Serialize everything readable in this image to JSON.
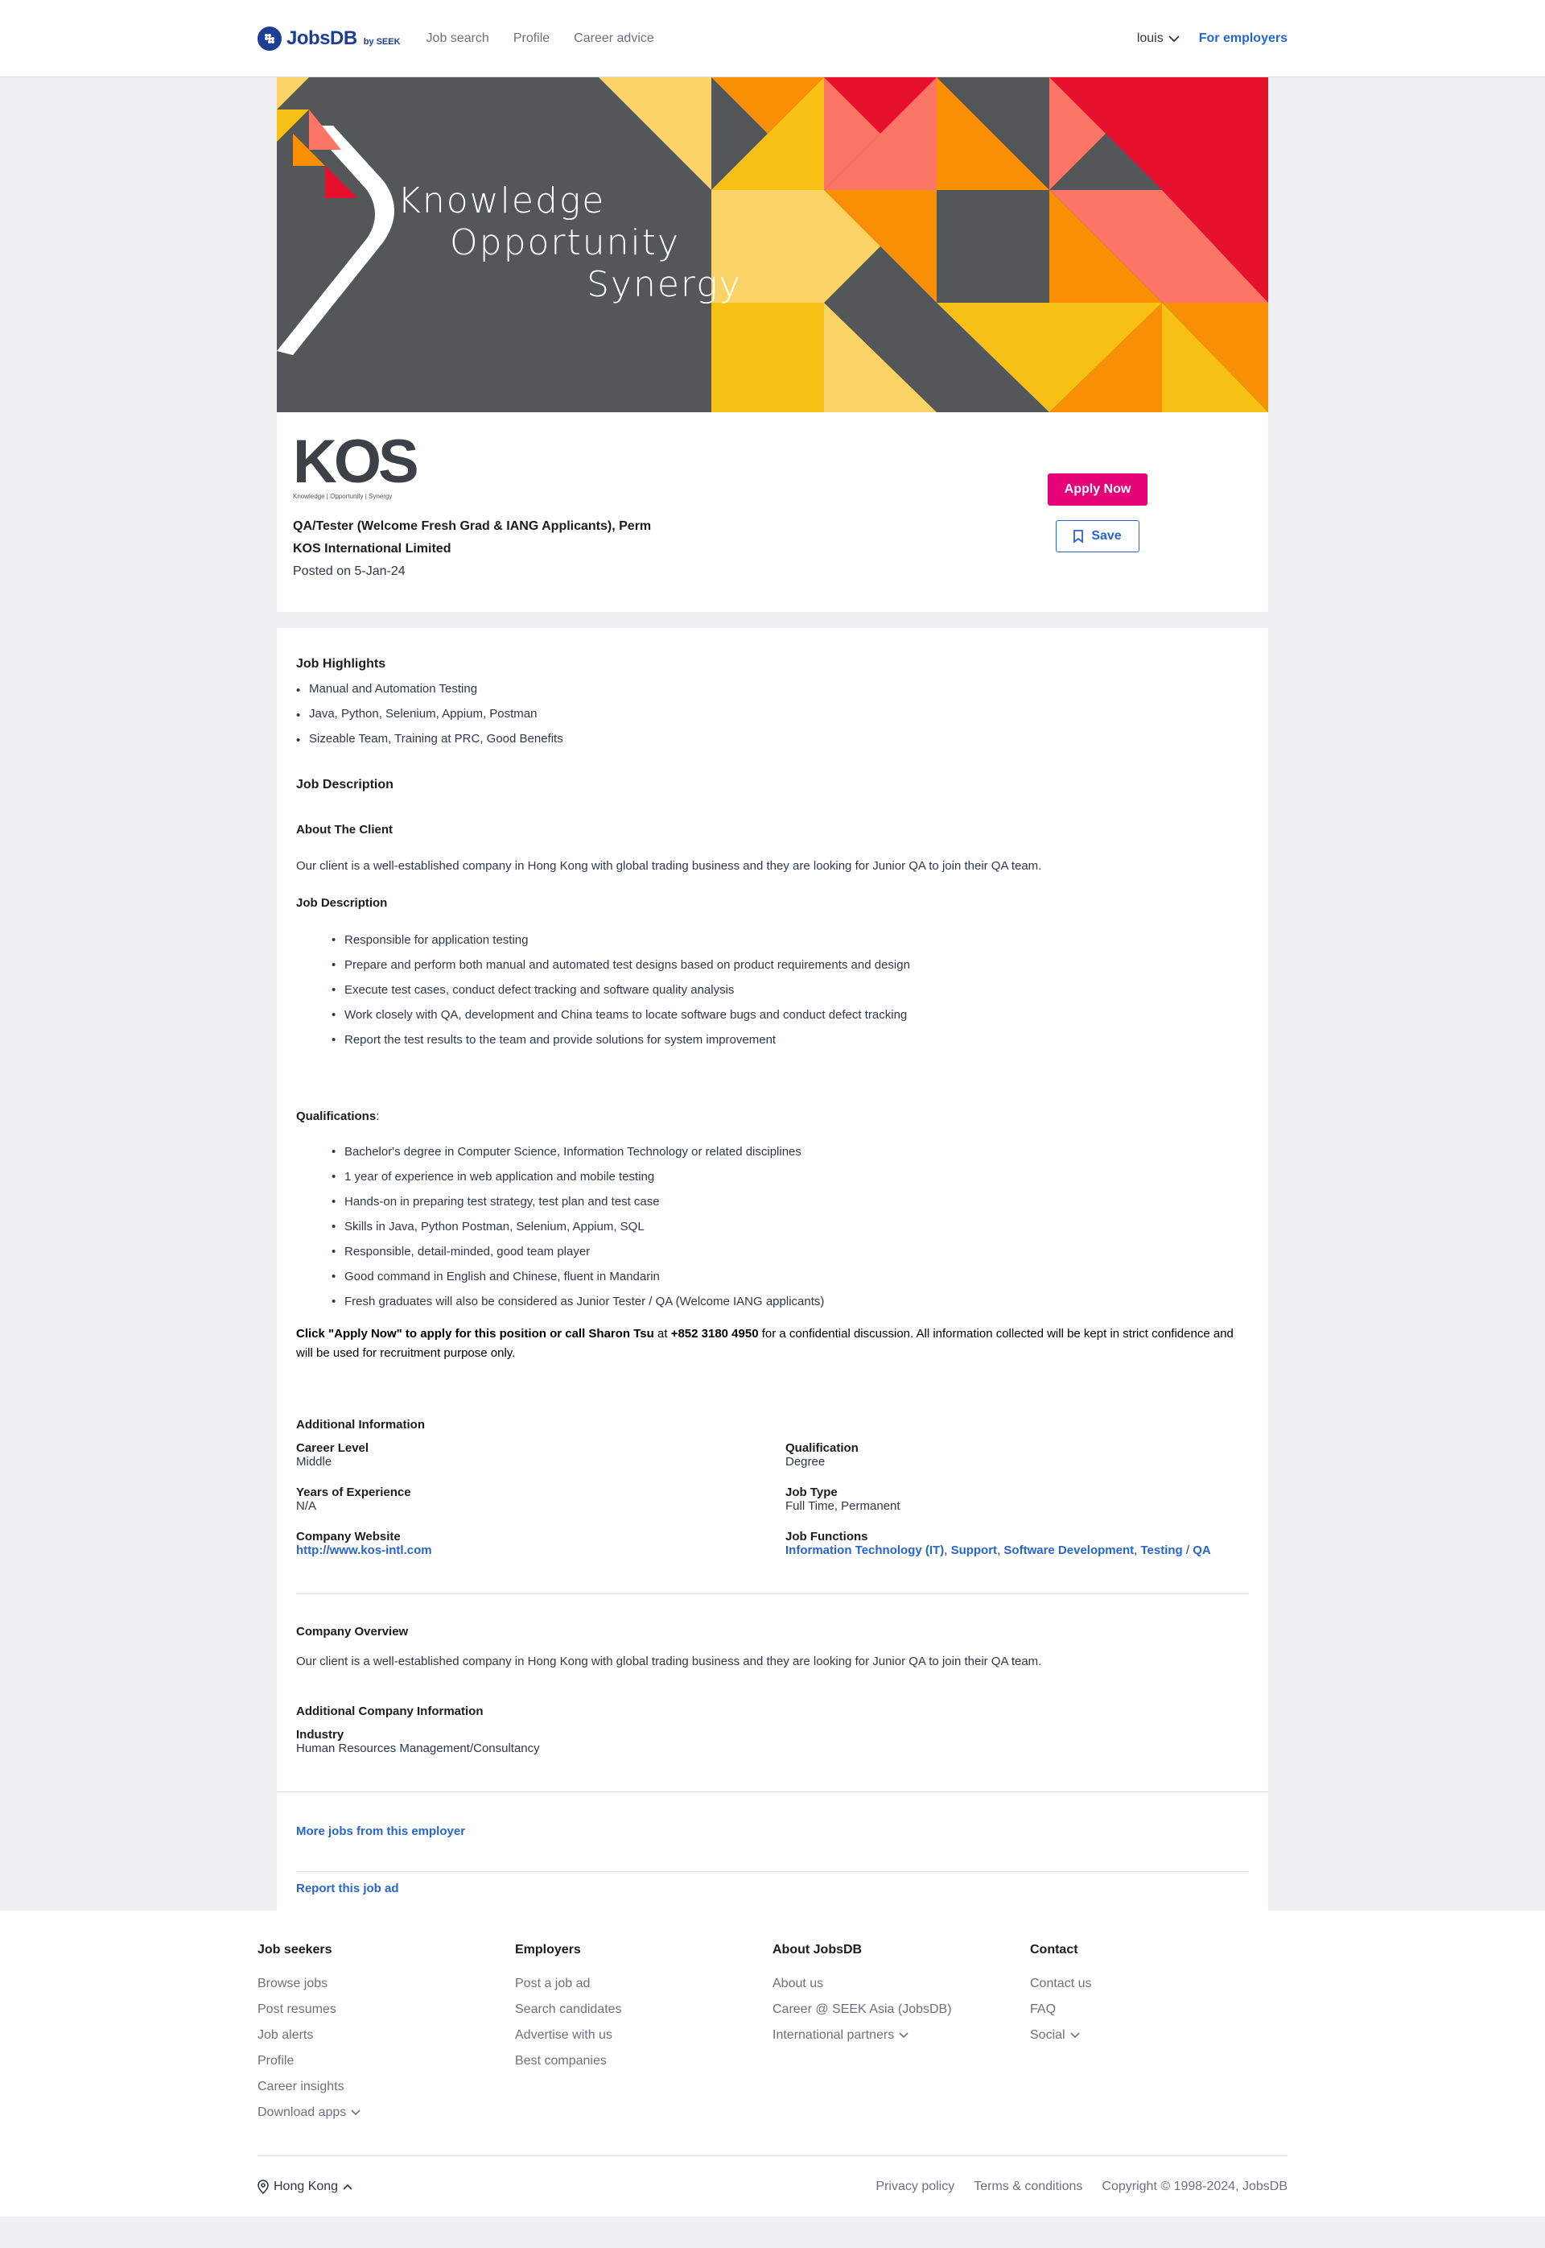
{
  "header": {
    "logo_text": "JobsDB",
    "logo_sub": "by SEEK",
    "nav": [
      "Job search",
      "Profile",
      "Career advice"
    ],
    "user": "louis",
    "employers": "For employers"
  },
  "banner": {
    "line1": "Knowledge",
    "line2": "Opportunity",
    "line3": "Synergy",
    "colors": {
      "gray": "#54575a",
      "yellow": "#f6c014",
      "light_yellow": "#f9d366",
      "orange": "#f98f05",
      "salmon": "#fa7566",
      "red": "#e8112d",
      "white": "#ffffff"
    }
  },
  "job": {
    "company_logo": "KOS",
    "company_logo_tag": "Knowledge | Opportunity | Synergy",
    "title": "QA/Tester (Welcome Fresh Grad & IANG Applicants), Perm",
    "company": "KOS International Limited",
    "posted": "Posted on 5-Jan-24",
    "apply_label": "Apply Now",
    "save_label": "Save",
    "colors": {
      "apply": "#e60278",
      "link": "#2765cf"
    }
  },
  "details": {
    "highlights_title": "Job Highlights",
    "highlights": [
      "Manual and Automation Testing",
      "Java, Python, Selenium, Appium, Postman",
      "Sizeable Team, Training at PRC, Good Benefits"
    ],
    "job_description_title": "Job Description",
    "about_title": "About The Client",
    "about_text": "Our client is a well-established company in Hong Kong with global trading business and they are looking for Junior QA to join their QA team.",
    "jd_subtitle": "Job Description",
    "duties": [
      "Responsible for application testing",
      "Prepare and perform both manual and automated test designs based on product requirements and design",
      "Execute test cases, conduct defect tracking and software quality analysis",
      "Work closely with QA, development and China teams to locate software bugs and conduct defect tracking",
      "Report the test results to the team and provide solutions for system improvement"
    ],
    "qual_title": "Qualifications",
    "qual_colon": ":",
    "qualifications": [
      "Bachelor's degree in Computer Science, Information Technology or related disciplines",
      "1 year of experience in web application and mobile testing",
      "Hands-on in preparing test strategy, test plan and test case",
      "Skills in Java, Python Postman, Selenium, Appium, SQL",
      "Responsible, detail-minded, good team player",
      "Good command in English and Chinese, fluent in Mandarin",
      "Fresh graduates will also be considered as Junior Tester / QA (Welcome IANG applicants)"
    ],
    "cta_bold1": "Click \"Apply Now\" to apply for this position or call Sharon Tsu",
    "cta_at": " at ",
    "cta_phone": "+852 3180 4950",
    "cta_rest": " for a confidential discussion. All information collected will be kept in strict confidence and will be used for recruitment purpose only."
  },
  "additional": {
    "title": "Additional Information",
    "career_level_label": "Career Level",
    "career_level": "Middle",
    "qualification_label": "Qualification",
    "qualification": "Degree",
    "experience_label": "Years of Experience",
    "experience": "N/A",
    "job_type_label": "Job Type",
    "job_type": "Full Time, Permanent",
    "website_label": "Company Website",
    "website": "http://www.kos-intl.com",
    "functions_label": "Job Functions",
    "function_1": "Information Technology (IT)",
    "function_sep_1": ", ",
    "function_2": "Support",
    "function_sep_2": ", ",
    "function_3": "Software Development",
    "function_sep_3": ", ",
    "function_4": "Testing",
    "function_sep_4": " / ",
    "function_5": "QA"
  },
  "company": {
    "overview_title": "Company Overview",
    "overview_text": "Our client is a well-established company in Hong Kong with global trading business and they are looking for Junior QA to join their QA team.",
    "additional_title": "Additional Company Information",
    "industry_label": "Industry",
    "industry": "Human Resources Management/Consultancy"
  },
  "links": {
    "more_jobs": "More jobs from this employer",
    "report": "Report this job ad"
  },
  "footer": {
    "job_seekers_title": "Job seekers",
    "job_seekers": [
      "Browse jobs",
      "Post resumes",
      "Job alerts",
      "Profile",
      "Career insights",
      "Download apps"
    ],
    "employers_title": "Employers",
    "employers": [
      "Post a job ad",
      "Search candidates",
      "Advertise with us",
      "Best companies"
    ],
    "about_title": "About JobsDB",
    "about": [
      "About us",
      "Career @ SEEK Asia (JobsDB)",
      "International partners"
    ],
    "contact_title": "Contact",
    "contact": [
      "Contact us",
      "FAQ",
      "Social"
    ],
    "region": "Hong Kong",
    "privacy": "Privacy policy",
    "terms": "Terms & conditions",
    "copyright": "Copyright © 1998-2024, JobsDB"
  }
}
